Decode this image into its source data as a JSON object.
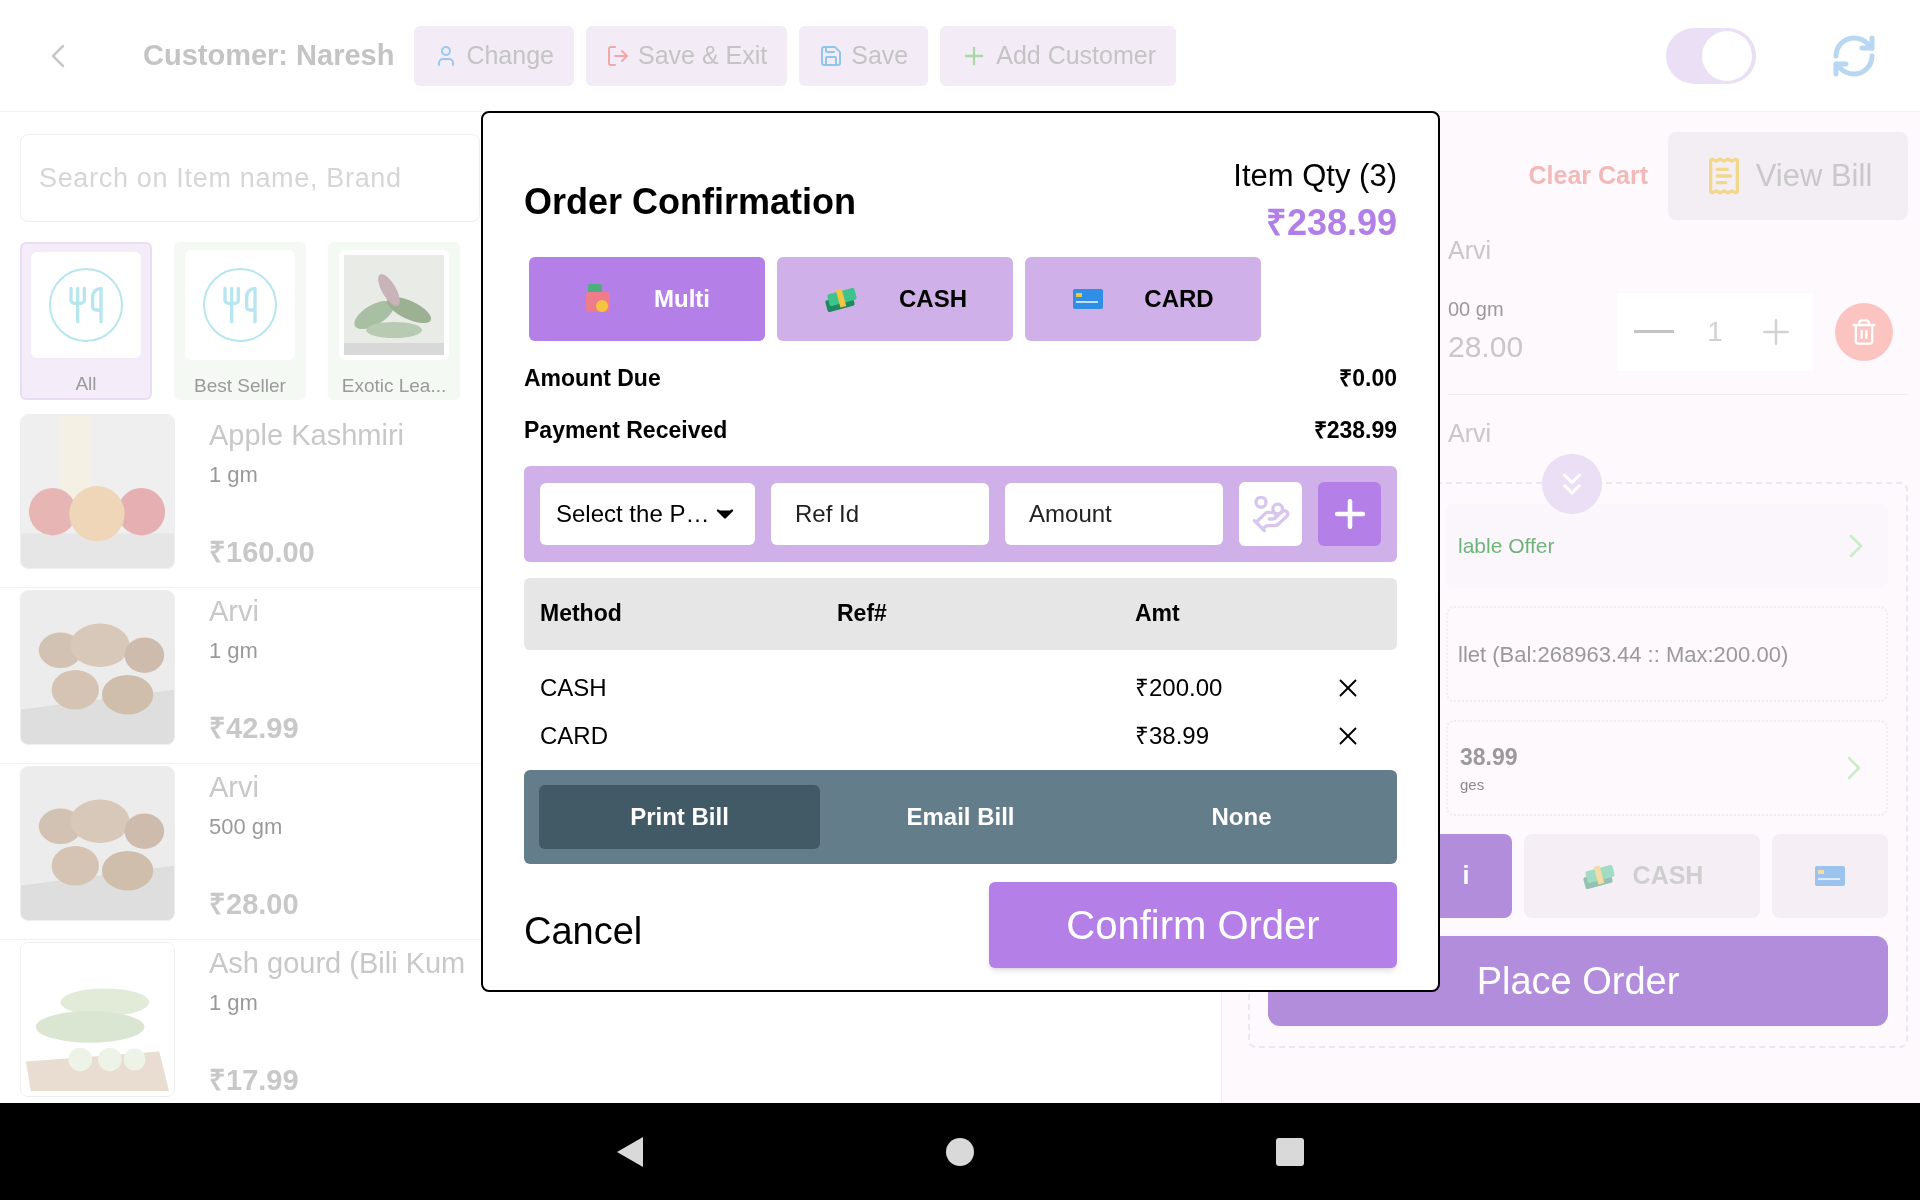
{
  "top_bar": {
    "customer": "Customer: Naresh",
    "buttons": [
      {
        "label": "Change",
        "kind": "user"
      },
      {
        "label": "Save & Exit",
        "kind": "exit"
      },
      {
        "label": "Save",
        "kind": "save"
      },
      {
        "label": "Add Customer",
        "kind": "add"
      }
    ],
    "toggle": {
      "on": true
    }
  },
  "search": {
    "placeholder": "Search on Item name, Brand"
  },
  "categories": [
    {
      "label": "All",
      "selected": true,
      "kind": "icon"
    },
    {
      "label": "Best Seller",
      "selected": false,
      "kind": "icon"
    },
    {
      "label": "Exotic Lea...",
      "selected": false,
      "kind": "picture"
    }
  ],
  "products": [
    {
      "name": "Apple Kashmiri",
      "unit": "1 gm",
      "price": "₹160.00",
      "kind": "apple"
    },
    {
      "name": "Arvi",
      "unit": "1 gm",
      "price": "₹42.99",
      "kind": "root"
    },
    {
      "name": "Arvi",
      "unit": "500 gm",
      "price": "₹28.00",
      "kind": "root"
    },
    {
      "name": "Ash gourd (Bili Kum",
      "unit": "1 gm",
      "price": "₹17.99",
      "kind": "gourd"
    }
  ],
  "cart": {
    "clear": "Clear Cart",
    "view_bill": "View Bill",
    "item": {
      "name": "Arvi",
      "unit": "00 gm",
      "price": "28.00",
      "qty": "1"
    },
    "next_item": {
      "name": "Arvi"
    },
    "offer": "lable Offer",
    "wallet": "llet (Bal:268963.44 :: Max:200.00)",
    "total": "38.99",
    "total_note": "ges",
    "payment_tiles": [
      {
        "label": "i",
        "kind": "multi",
        "selected": true
      },
      {
        "label": "CASH",
        "kind": "cash",
        "selected": false
      },
      {
        "kind": "card",
        "selected": false
      }
    ],
    "place_order": "Place Order"
  },
  "dialog": {
    "title": "Order Confirmation",
    "item_qty": "Item Qty (3)",
    "total": "₹238.99",
    "modes": [
      {
        "label": "Multi",
        "kind": "multi",
        "selected": true
      },
      {
        "label": "CASH",
        "kind": "cash",
        "selected": false
      },
      {
        "label": "CARD",
        "kind": "card",
        "selected": false
      }
    ],
    "summary": [
      {
        "label": "Amount Due",
        "value": "₹0.00"
      },
      {
        "label": "Payment Received",
        "value": "₹238.99"
      }
    ],
    "entry": {
      "select_placeholder": "Select the P…",
      "ref_placeholder": "Ref Id",
      "amount_placeholder": "Amount"
    },
    "table": {
      "columns": [
        "Method",
        "Ref#",
        "Amt"
      ],
      "rows": [
        {
          "method": "CASH",
          "amt": "₹200.00"
        },
        {
          "method": "CARD",
          "amt": "₹38.99"
        }
      ]
    },
    "bill_options": [
      {
        "label": "Print Bill",
        "selected": true
      },
      {
        "label": "Email Bill",
        "selected": false
      },
      {
        "label": "None",
        "selected": false
      }
    ],
    "cancel": "Cancel",
    "confirm": "Confirm Order"
  }
}
